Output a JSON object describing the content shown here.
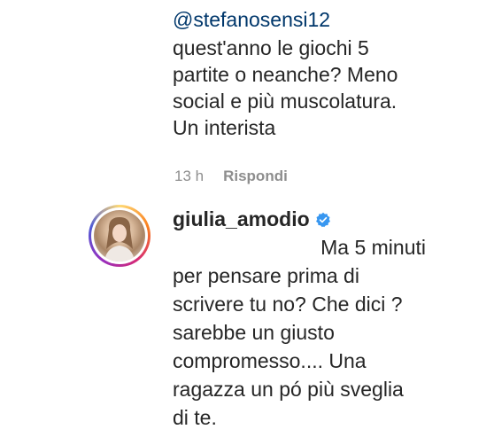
{
  "top_comment": {
    "mention": "@stefanosensi12",
    "text": "quest'anno le giochi 5\npartite o neanche? Meno\nsocial e più muscolatura.\nUn interista"
  },
  "meta": {
    "time": "13 h",
    "reply_label": "Rispondi"
  },
  "reply": {
    "username": "giulia_amodio",
    "first_line": "Ma 5 minuti",
    "rest": "per pensare prima di\nscrivere tu no? Che dici ?\nsarebbe un giusto\ncompromesso.... Una\nragazza un pó più sveglia\ndi te."
  },
  "colors": {
    "mention": "#00376b",
    "verified": "#3897f0",
    "meta": "#8e8e8e"
  }
}
